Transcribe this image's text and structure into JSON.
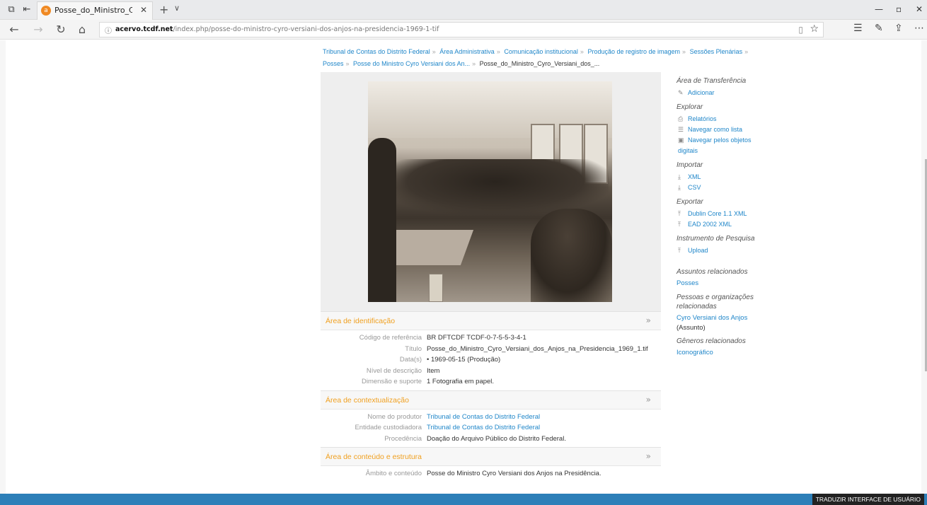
{
  "browser": {
    "tab_title": "Posse_do_Ministro_Cyrc",
    "url_domain": "acervo.tcdf.net",
    "url_path": "/index.php/posse-do-ministro-cyro-versiani-dos-anjos-na-presidencia-1969-1-tif"
  },
  "breadcrumb": {
    "items": [
      "Tribunal de Contas do Distrito Federal",
      "Área Administrativa",
      "Comunicação institucional",
      "Produção de registro de imagem",
      "Sessões Plenárias",
      "Posses",
      "Posse do Ministro Cyro Versiani dos An..."
    ],
    "current": "Posse_do_Ministro_Cyro_Versiani_dos_..."
  },
  "sections": [
    {
      "title": "Área de identificação",
      "fields": [
        {
          "label": "Código de referência",
          "value": "BR DFTCDF TCDF-0-7-5-5-3-4-1",
          "link": false
        },
        {
          "label": "Título",
          "value": "Posse_do_Ministro_Cyro_Versiani_dos_Anjos_na_Presidencia_1969_1.tif",
          "link": false
        },
        {
          "label": "Data(s)",
          "value": "•  1969-05-15 (Produção)",
          "link": false
        },
        {
          "label": "Nível de descrição",
          "value": "Item",
          "link": false
        },
        {
          "label": "Dimensão e suporte",
          "value": "1 Fotografia em papel.",
          "link": false
        }
      ]
    },
    {
      "title": "Área de contextualização",
      "fields": [
        {
          "label": "Nome do produtor",
          "value": "Tribunal de Contas do Distrito Federal",
          "link": true
        },
        {
          "label": "Entidade custodiadora",
          "value": "Tribunal de Contas do Distrito Federal",
          "link": true
        },
        {
          "label": "Procedência",
          "value": "Doação do Arquivo Público do Distrito Federal.",
          "link": false
        }
      ]
    },
    {
      "title": "Área de conteúdo e estrutura",
      "fields": [
        {
          "label": "Âmbito e conteúdo",
          "value": "Posse do Ministro Cyro Versiani dos Anjos na Presidência.",
          "link": false
        }
      ]
    }
  ],
  "sidebar": {
    "transfer_heading": "Área de Transferência",
    "add": "Adicionar",
    "explore_heading": "Explorar",
    "reports": "Relatórios",
    "browse_list": "Navegar como lista",
    "browse_digital": "Navegar pelos objetos digitais",
    "import_heading": "Importar",
    "xml": "XML",
    "csv": "CSV",
    "export_heading": "Exportar",
    "dublin": "Dublin Core 1.1 XML",
    "ead": "EAD 2002 XML",
    "finding_aid_heading": "Instrumento de Pesquisa",
    "upload": "Upload",
    "subjects_heading": "Assuntos relacionados",
    "subject_1": "Posses",
    "people_heading": "Pessoas e organizações relacionadas",
    "person_1": "Cyro Versiani dos Anjos",
    "person_1_role": "(Assunto)",
    "genres_heading": "Gêneros relacionados",
    "genre_1": "Iconográfico"
  },
  "footer": {
    "translate": "TRADUZIR INTERFACE DE USUÁRIO"
  },
  "colors": {
    "link": "#1f86c9",
    "section_title": "#f0a020",
    "footer": "#2d7fb8"
  }
}
